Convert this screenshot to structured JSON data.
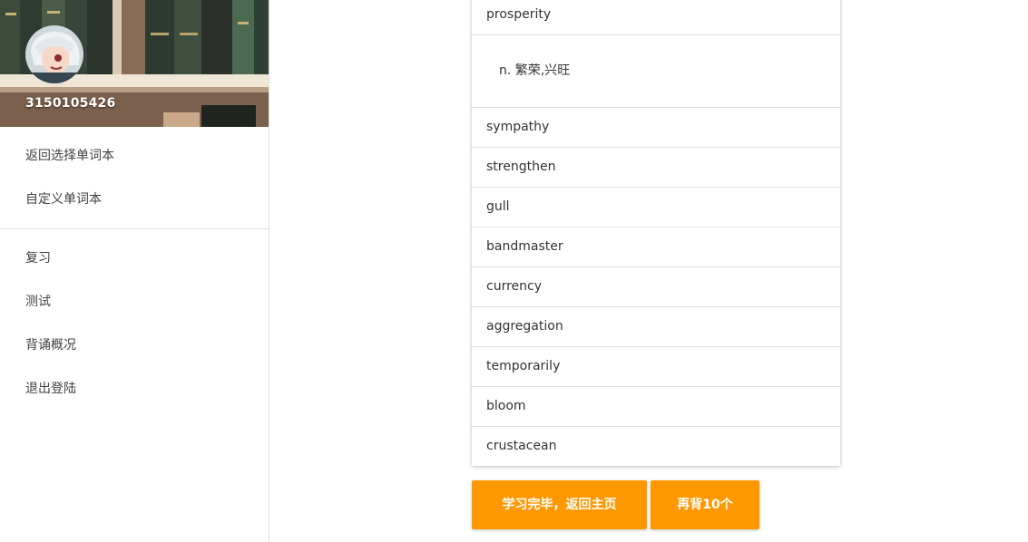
{
  "sidebar": {
    "user_id": "3150105426",
    "nav_primary": [
      {
        "label": "返回选择单词本"
      },
      {
        "label": "自定义单词本"
      }
    ],
    "nav_secondary": [
      {
        "label": "复习"
      },
      {
        "label": "测试"
      },
      {
        "label": "背诵概况"
      },
      {
        "label": "退出登陆"
      }
    ]
  },
  "word_list": {
    "expanded_word": "prosperity",
    "expanded_definition": "n. 繁荣,兴旺",
    "words": [
      "sympathy",
      "strengthen",
      "gull",
      "bandmaster",
      "currency",
      "aggregation",
      "temporarily",
      "bloom",
      "crustacean"
    ]
  },
  "actions": {
    "finish_label": "学习完毕，返回主页",
    "more_label": "再背10个"
  },
  "colors": {
    "accent": "#ff9800",
    "divider": "#e0e0e0"
  }
}
